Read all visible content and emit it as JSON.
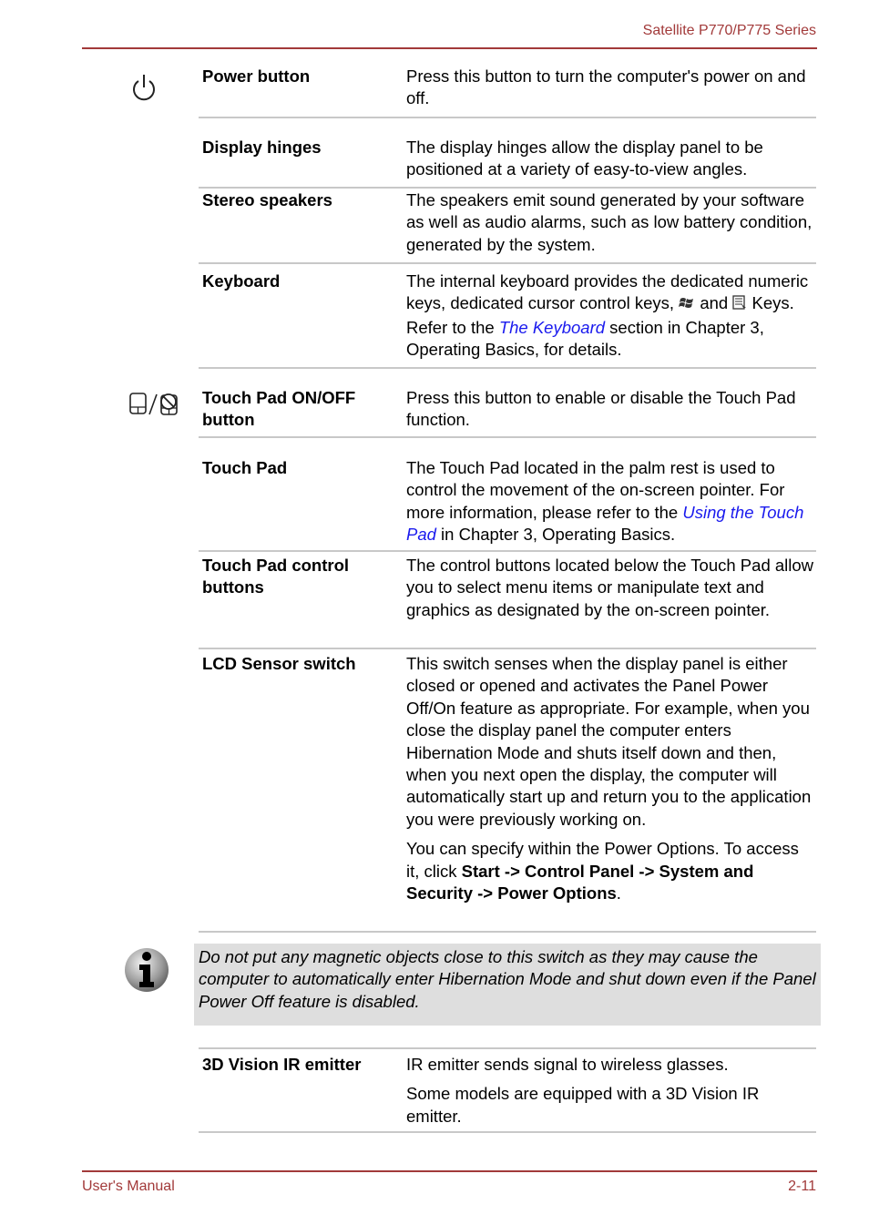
{
  "header": {
    "title": "Satellite P770/P775 Series"
  },
  "footer": {
    "left": "User's Manual",
    "right": "2-11"
  },
  "colors": {
    "accent": "#a23a3a",
    "link": "#1a1aee",
    "note_bg": "#dedede",
    "rule": "#c8c8c8"
  },
  "icons": {
    "power": "power-icon",
    "touchpad_toggle": "touchpad-on-off-icon",
    "windows_key": "windows-key-icon",
    "application_key": "application-key-icon",
    "info": "info-icon"
  },
  "rows": [
    {
      "term": "Power button",
      "desc": "Press this button to turn the computer's power on and off."
    },
    {
      "term": "Display hinges",
      "desc": "The display hinges allow the display panel to be positioned at a variety of easy-to-view angles."
    },
    {
      "term": "Stereo speakers",
      "desc": "The speakers emit sound generated by your software as well as audio alarms, such as low battery condition, generated by the system."
    },
    {
      "term": "Keyboard",
      "desc_a": "The internal keyboard provides the dedicated numeric keys, dedicated cursor control keys, ",
      "desc_b": " and ",
      "desc_c": " Keys. Refer to the ",
      "link": "The Keyboard",
      "desc_d": " section in Chapter 3, Operating Basics, for details."
    },
    {
      "term": "Touch Pad ON/OFF button",
      "desc": "Press this button to enable or disable the Touch Pad function."
    },
    {
      "term": "Touch Pad",
      "desc_a": "The Touch Pad located in the palm rest is used to control the movement of the on-screen pointer. For more information, please refer to the ",
      "link": "Using the Touch Pad",
      "desc_b": " in Chapter 3, Operating Basics."
    },
    {
      "term": "Touch Pad control buttons",
      "desc": "The control buttons located below the Touch Pad allow you to select menu items or manipulate text and graphics as designated by the on-screen pointer."
    },
    {
      "term": "LCD Sensor switch",
      "desc": "This switch senses when the display panel is either closed or opened and activates the Panel Power Off/On feature as appropriate. For example, when you close the display panel the computer enters Hibernation Mode and shuts itself down and then, when you next open the display, the computer will automatically start up and return you to the application you were previously working on.",
      "desc2_a": "You can specify within the Power Options. To access it, click ",
      "desc2_bold": "Start -> Control Panel -> System and Security -> Power Options",
      "desc2_b": "."
    }
  ],
  "note": {
    "text": "Do not put any magnetic objects close to this switch as they may cause the computer to automatically enter Hibernation Mode and shut down even if the Panel Power Off feature is disabled."
  },
  "row_3d": {
    "term": "3D Vision IR emitter",
    "desc": "IR emitter sends signal to wireless glasses.",
    "desc2": "Some models are equipped with a 3D Vision IR emitter."
  }
}
